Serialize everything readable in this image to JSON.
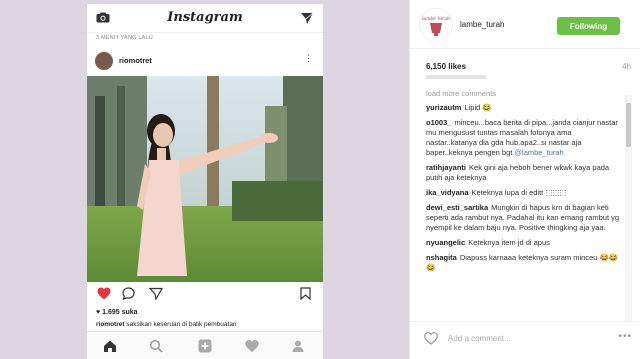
{
  "phone": {
    "logo": "Instagram",
    "time_ago": "3 MENIT YANG LALU",
    "username": "riomotret",
    "more": "⋮",
    "likes": "1.695 suka",
    "caption_user": "riomotret",
    "caption_text": "saksikan keseruan di balik pembuatan"
  },
  "panel": {
    "username": "lambe_turah",
    "follow_label": "Following",
    "likes": "6,150 likes",
    "ago": "4h",
    "load_more": "load more comments",
    "add_comment_placeholder": "Add a comment...",
    "more": "•••",
    "comments": [
      {
        "user": "yurizautm",
        "text": "Lipid 😂"
      },
      {
        "user": "o1003_",
        "text": "minceu...baca berita di pipa...janda cianjur nastar mu mengusust tuntas masalah fotonya ama nastar..katanya dia gda hub.apa2..si nastar aja baper..keknya pengen bgt",
        "tag": "@lambe_turah"
      },
      {
        "user": "ratihjayanti",
        "text": "Kek gini aja heboh bener wkwk kaya pada putih aja keteknya"
      },
      {
        "user": "ika_vidyana",
        "text": "Keteknya lupa di editt ⬚⬚⬚"
      },
      {
        "user": "dewi_esti_sartika",
        "text": "Mungkin di hapus krn di bagian keti seperti ada rambut nya. Padahal itu kan emang rambut yg nyempil ke dalam baju nya. Positive thingking aja yaa."
      },
      {
        "user": "nyuangelic",
        "text": "Keteknya item jd di apus"
      },
      {
        "user": "nshagita",
        "text": "Diapuss karnaaa keteknya suram minceu 😂😂😂"
      }
    ]
  },
  "colors": {
    "follow": "#6cc04a",
    "like": "#e0393e",
    "tag": "#4a7aa6"
  }
}
